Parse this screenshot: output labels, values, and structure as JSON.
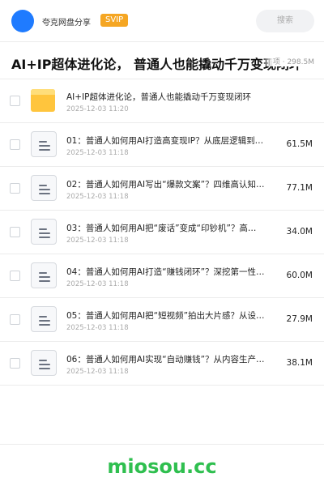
{
  "header": {
    "share_name": "夸克网盘分享",
    "badge": "SVIP",
    "search_placeholder": "搜索"
  },
  "title_bar": {
    "title": "AI+IP超体进化论， 普通人也能撬动千万变现闭环",
    "meta": "项 · 298.5M"
  },
  "items": [
    {
      "type": "folder",
      "icon": "folder-icon",
      "name": "AI+IP超体进化论，普通人也能撬动千万变现闭环",
      "date": "2025-12-03 11:20",
      "size": ""
    },
    {
      "type": "file",
      "icon": "document-icon",
      "name": "01：普通人如何用AI打造高变现IP？从底层逻辑到…",
      "date": "2025-12-03 11:18",
      "size": "61.5M"
    },
    {
      "type": "file",
      "icon": "document-icon",
      "name": "02：普通人如何用AI写出“爆款文案”？四维高认知…",
      "date": "2025-12-03 11:18",
      "size": "77.1M"
    },
    {
      "type": "file",
      "icon": "document-icon",
      "name": "03：普通人如何用AI把“废话”变成“印钞机”？高…",
      "date": "2025-12-03 11:18",
      "size": "34.0M"
    },
    {
      "type": "file",
      "icon": "document-icon",
      "name": "04：普通人如何用AI打造“赚钱闭环”？深挖第一性…",
      "date": "2025-12-03 11:18",
      "size": "60.0M"
    },
    {
      "type": "file",
      "icon": "document-icon",
      "name": "05：普通人如何用AI把“短视频”拍出大片感？从设…",
      "date": "2025-12-03 11:18",
      "size": "27.9M"
    },
    {
      "type": "file",
      "icon": "document-icon",
      "name": "06：普通人如何用AI实现“自动赚钱”？从内容生产…",
      "date": "2025-12-03 11:18",
      "size": "38.1M"
    }
  ],
  "footer": {
    "brand": "miosou.cc"
  },
  "colors": {
    "avatar": "#1f7bff",
    "badge": "#f5a623",
    "folder": "#ffc53d",
    "brand": "#2fbf4f"
  }
}
